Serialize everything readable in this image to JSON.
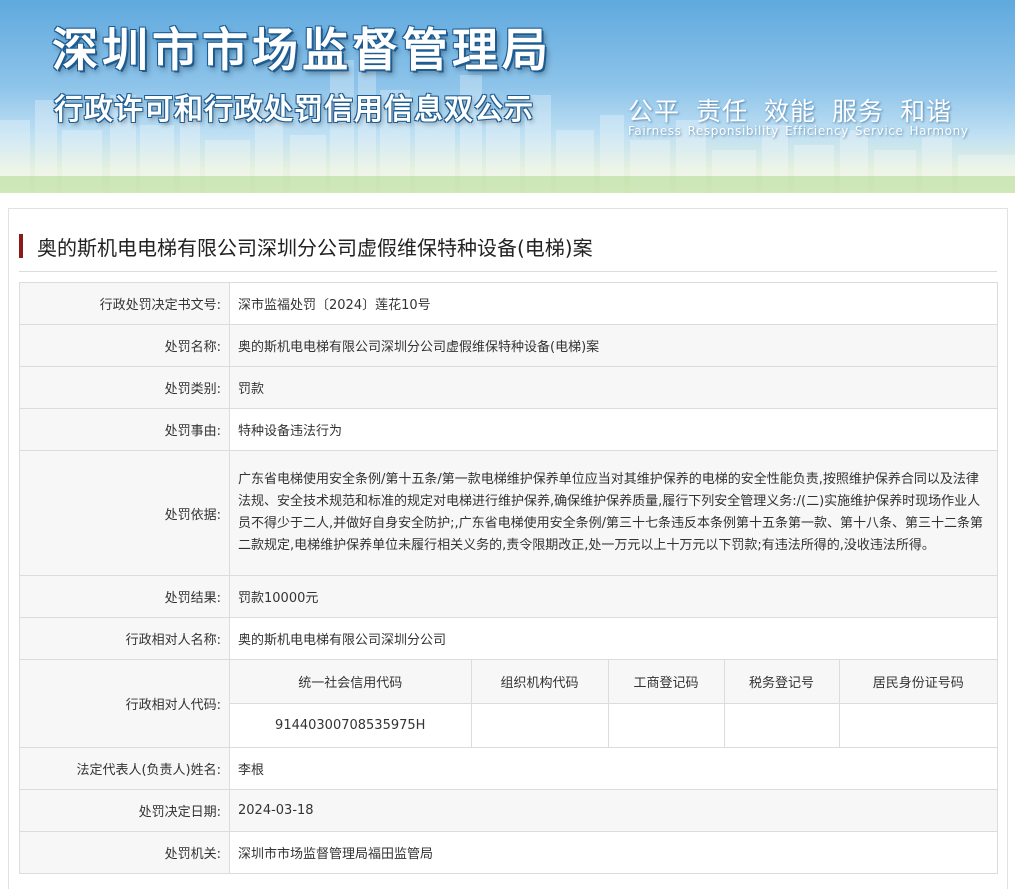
{
  "banner": {
    "title": "深圳市市场监督管理局",
    "subtitle": "行政许可和行政处罚信用信息双公示",
    "slogans": [
      "公平",
      "责任",
      "效能",
      "服务",
      "和谐"
    ],
    "slogans_en": [
      "Fairness",
      "Responsibility",
      "Efficiency",
      "Service",
      "Harmony"
    ]
  },
  "case_title": "奥的斯机电电梯有限公司深圳分公司虚假维保特种设备(电梯)案",
  "fields": {
    "doc_no": {
      "label": "行政处罚决定书文号:",
      "value": "深市监福处罚〔2024〕莲花10号"
    },
    "name": {
      "label": "处罚名称:",
      "value": "奥的斯机电电梯有限公司深圳分公司虚假维保特种设备(电梯)案"
    },
    "category": {
      "label": "处罚类别:",
      "value": "罚款"
    },
    "reason": {
      "label": "处罚事由:",
      "value": "特种设备违法行为"
    },
    "basis": {
      "label": "处罚依据:",
      "value": "广东省电梯使用安全条例/第十五条/第一款电梯维护保养单位应当对其维护保养的电梯的安全性能负责,按照维护保养合同以及法律法规、安全技术规范和标准的规定对电梯进行维护保养,确保维护保养质量,履行下列安全管理义务:/(二)实施维护保养时现场作业人员不得少于二人,并做好自身安全防护;,广东省电梯使用安全条例/第三十七条违反本条例第十五条第一款、第十八条、第三十二条第二款规定,电梯维护保养单位未履行相关义务的,责令限期改正,处一万元以上十万元以下罚款;有违法所得的,没收违法所得。"
    },
    "result": {
      "label": "处罚结果:",
      "value": "罚款10000元"
    },
    "party_name": {
      "label": "行政相对人名称:",
      "value": "奥的斯机电电梯有限公司深圳分公司"
    },
    "party_code": {
      "label": "行政相对人代码:",
      "headers": [
        "统一社会信用代码",
        "组织机构代码",
        "工商登记码",
        "税务登记号",
        "居民身份证号码"
      ],
      "values": [
        "91440300708535975H",
        "",
        "",
        "",
        ""
      ]
    },
    "legal_rep": {
      "label": "法定代表人(负责人)姓名:",
      "value": "李根"
    },
    "date": {
      "label": "处罚决定日期:",
      "value": "2024-03-18"
    },
    "authority": {
      "label": "处罚机关:",
      "value": "深圳市市场监督管理局福田监管局"
    }
  },
  "colors": {
    "title_bar": "#8b1a1a",
    "border": "#dcdcdc",
    "alt_row": "#f7f7f7"
  }
}
